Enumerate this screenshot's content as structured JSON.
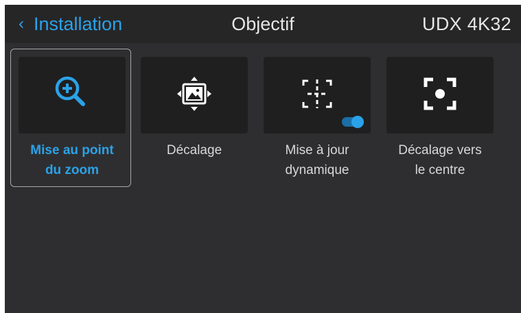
{
  "header": {
    "back_label": "Installation",
    "title": "Objectif",
    "model": "UDX 4K32"
  },
  "tiles": [
    {
      "label": "Mise au point\ndu zoom",
      "icon": "zoom-focus-icon",
      "selected": true
    },
    {
      "label": "Décalage",
      "icon": "lens-shift-icon",
      "selected": false
    },
    {
      "label": "Mise à jour\ndynamique",
      "icon": "dynamic-update-icon",
      "selected": false,
      "toggle": "on"
    },
    {
      "label": "Décalage vers\nle centre",
      "icon": "shift-to-center-icon",
      "selected": false
    }
  ],
  "colors": {
    "accent": "#2ba2e8",
    "background": "#2e2e30",
    "header": "#262627",
    "tile": "#1f1f20",
    "text": "#e6e6e6"
  }
}
